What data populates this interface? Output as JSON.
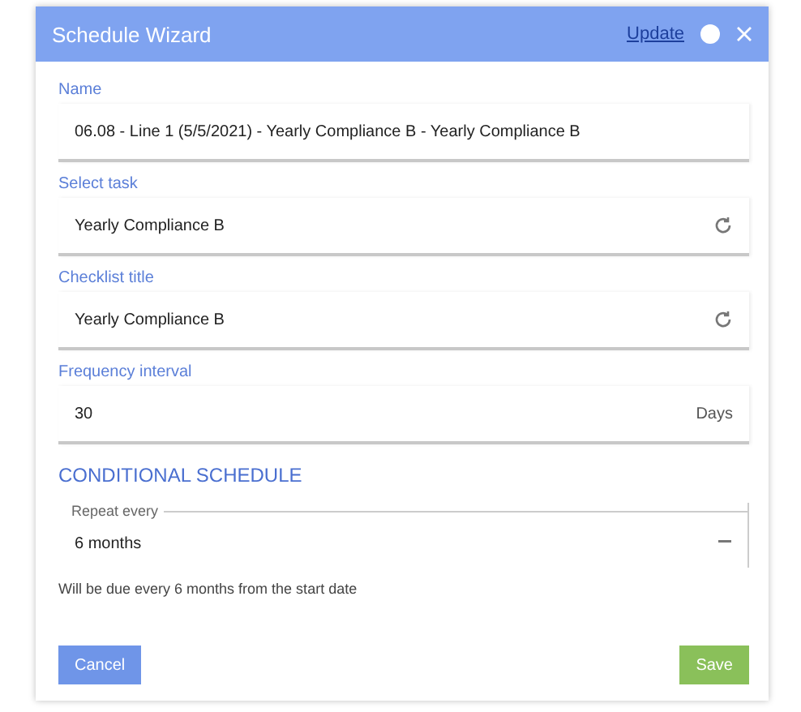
{
  "window": {
    "title": "Schedule Wizard",
    "link": "Update"
  },
  "fields": [
    {
      "kind": "text",
      "label": "Name",
      "value": "06.08 - Line 1 (5/5/2021) - Yearly Compliance B - Yearly Compliance B"
    },
    {
      "kind": "picker",
      "label": "Select task",
      "value": "Yearly Compliance B"
    },
    {
      "kind": "picker",
      "label": "Checklist title",
      "value": "Yearly Compliance B"
    },
    {
      "kind": "unit",
      "label": "Frequency interval",
      "value": "30",
      "unit": "Days"
    }
  ],
  "section": {
    "title": "CONDITIONAL SCHEDULE",
    "select": {
      "label": "Repeat every",
      "value": "6 months"
    },
    "note": "Will be due every 6 months from the start date"
  },
  "buttons": [
    {
      "label": "Cancel",
      "kind": "secondary"
    },
    {
      "label": "Save",
      "kind": "primary"
    }
  ]
}
